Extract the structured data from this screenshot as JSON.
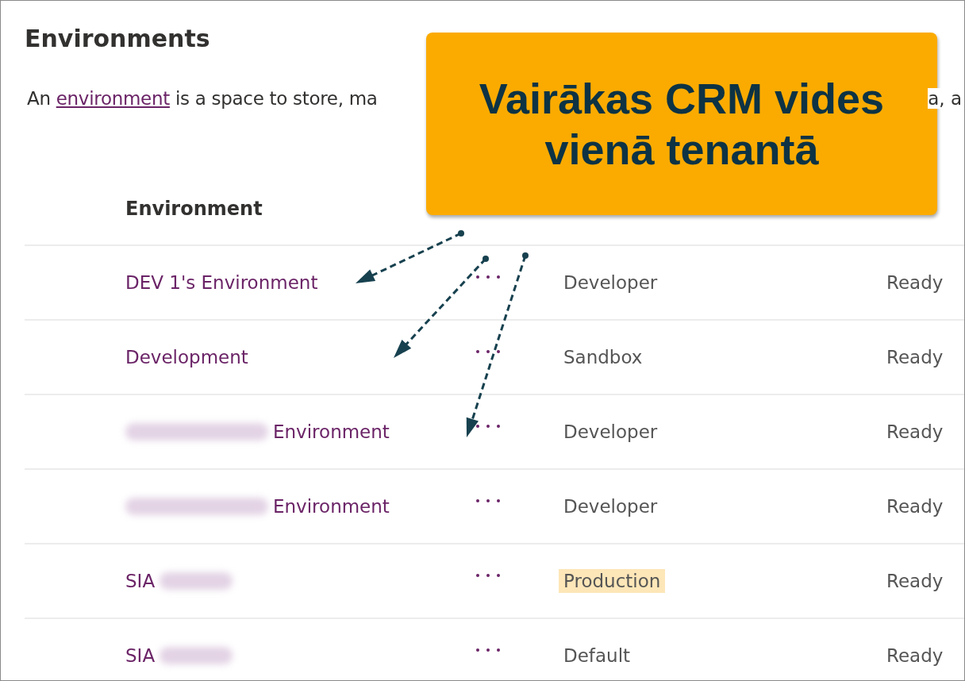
{
  "title": "Environments",
  "intro": {
    "before_link": "An ",
    "link": "environment",
    "after_link": " is a space to store, ma",
    "right_fragment": "a, a"
  },
  "columns": [
    "Environment"
  ],
  "rows": [
    {
      "name_before": "DEV 1's Environment",
      "redacted": false,
      "name_after": "",
      "type": "Developer",
      "highlighted": false,
      "state": "Ready"
    },
    {
      "name_before": "Development",
      "redacted": false,
      "name_after": "",
      "type": "Sandbox",
      "highlighted": false,
      "state": "Ready"
    },
    {
      "name_before": "",
      "redacted": true,
      "name_after": "Environment",
      "type": "Developer",
      "highlighted": false,
      "state": "Ready"
    },
    {
      "name_before": "",
      "redacted": true,
      "name_after": "Environment",
      "type": "Developer",
      "highlighted": false,
      "state": "Ready"
    },
    {
      "name_before": "SIA",
      "redacted": true,
      "name_after": "",
      "type": "Production",
      "highlighted": true,
      "state": "Ready"
    },
    {
      "name_before": "SIA",
      "redacted": true,
      "name_after": "",
      "type": "Default",
      "highlighted": false,
      "state": "Ready"
    }
  ],
  "callout": {
    "lines": [
      "Vairākas CRM vides",
      "vienā tenantā"
    ]
  }
}
